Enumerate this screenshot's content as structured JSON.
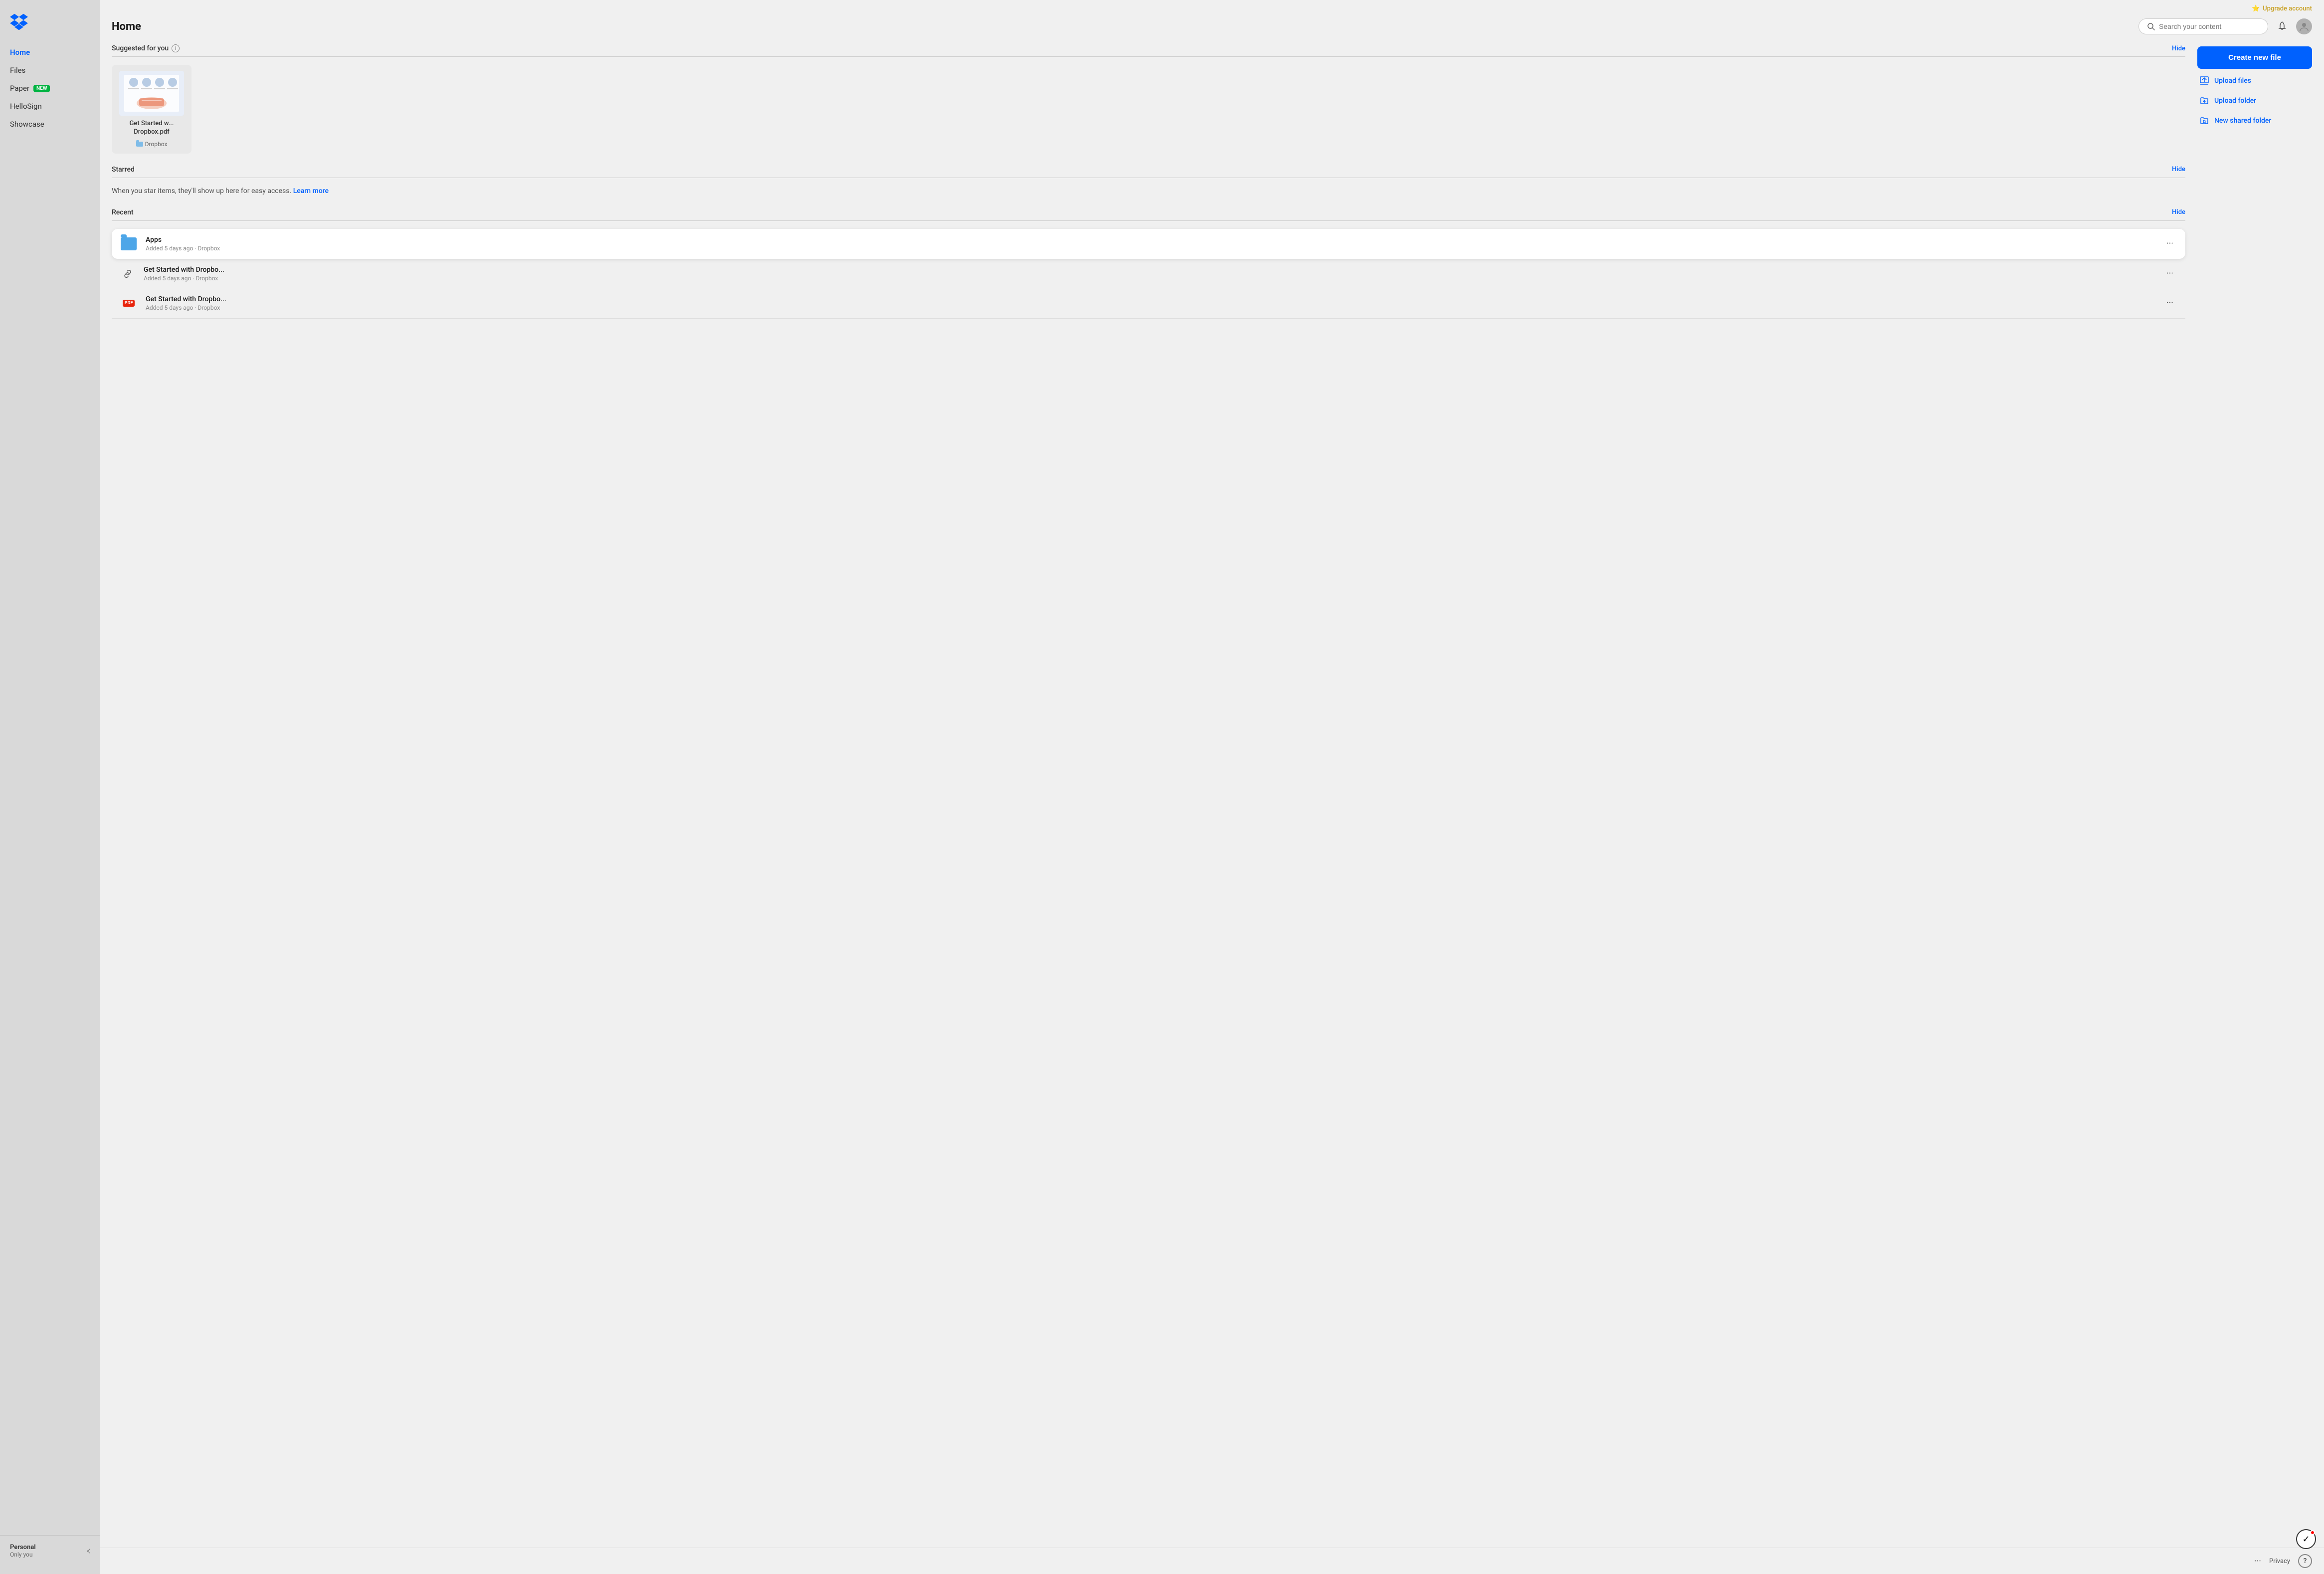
{
  "sidebar": {
    "logo_alt": "Dropbox logo",
    "nav_items": [
      {
        "id": "home",
        "label": "Home",
        "active": true
      },
      {
        "id": "files",
        "label": "Files",
        "active": false
      },
      {
        "id": "paper",
        "label": "Paper",
        "active": false,
        "badge": "New"
      },
      {
        "id": "hellosign",
        "label": "HelloSign",
        "active": false
      },
      {
        "id": "showcase",
        "label": "Showcase",
        "active": false
      }
    ],
    "footer": {
      "account_name": "Personal",
      "account_sub": "Only you"
    }
  },
  "header": {
    "upgrade_label": "Upgrade account",
    "page_title": "Home",
    "search_placeholder": "Search your content"
  },
  "sections": {
    "suggested": {
      "title": "Suggested for you",
      "hide_label": "Hide",
      "files": [
        {
          "name": "Get Started w... Dropbox.pdf",
          "location": "Dropbox"
        }
      ]
    },
    "starred": {
      "title": "Starred",
      "hide_label": "Hide",
      "empty_text": "When you star items, they'll show up here for easy access.",
      "learn_more": "Learn more"
    },
    "recent": {
      "title": "Recent",
      "hide_label": "Hide",
      "items": [
        {
          "type": "folder",
          "name": "Apps",
          "meta": "Added 5 days ago · Dropbox",
          "highlighted": true
        },
        {
          "type": "link",
          "name": "Get Started with Dropbo...",
          "meta": "Added 5 days ago · Dropbox",
          "highlighted": false
        },
        {
          "type": "pdf",
          "name": "Get Started with Dropbo...",
          "meta": "Added 5 days ago · Dropbox",
          "highlighted": false
        }
      ]
    }
  },
  "actions": {
    "create_new_file": "Create new file",
    "upload_files": "Upload files",
    "upload_folder": "Upload folder",
    "new_shared_folder": "New shared folder"
  },
  "footer": {
    "more_label": "...",
    "privacy_label": "Privacy",
    "help_label": "?"
  },
  "status_badge": {
    "icon": "✓"
  }
}
